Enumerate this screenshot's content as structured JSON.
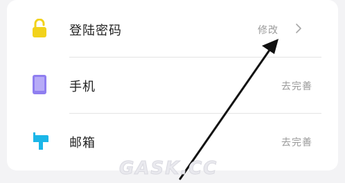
{
  "rows": [
    {
      "label": "登陆密码",
      "action": "修改",
      "icon": "lock-icon",
      "icon_color": "#f2d21b"
    },
    {
      "label": "手机",
      "action": "去完善",
      "icon": "phone-icon",
      "icon_color": "#8f7ef0"
    },
    {
      "label": "邮箱",
      "action": "去完善",
      "icon": "mailbox-icon",
      "icon_color": "#1bb6e8"
    }
  ],
  "watermark": "GASK.CC",
  "annotation": "arrow-pointing-to-modify"
}
